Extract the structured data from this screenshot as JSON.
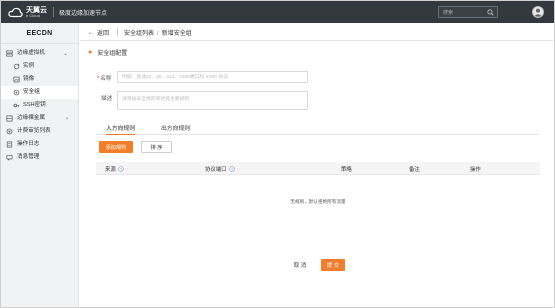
{
  "topbar": {
    "logo_main": "天翼云",
    "logo_sub": "e Cloud",
    "title": "极度边缘加速节点",
    "search_placeholder": "搜索"
  },
  "sidebar": {
    "brand": "EECDN",
    "items": [
      {
        "label": "边缘虚拟机",
        "icon": "server-icon",
        "expandable": true
      },
      {
        "label": "实例",
        "icon": "refresh-icon"
      },
      {
        "label": "镜像",
        "icon": "image-icon"
      },
      {
        "label": "安全组",
        "icon": "shield-icon",
        "active": true
      },
      {
        "label": "SSH密钥",
        "icon": "key-icon"
      },
      {
        "label": "边缘裸金属",
        "icon": "metal-server-icon",
        "expandable": true
      },
      {
        "label": "计费审览列表",
        "icon": "billing-icon"
      },
      {
        "label": "操作日志",
        "icon": "log-icon"
      },
      {
        "label": "消息管理",
        "icon": "message-icon"
      }
    ]
  },
  "breadcrumb": {
    "back": "返回",
    "parent": "安全组列表",
    "separator": "/",
    "current": "新增安全组"
  },
  "form": {
    "section_title": "安全组配置",
    "name_label": "名称",
    "name_required_mark": "*",
    "name_placeholder": "例如：放通22、80、443、3389端口和 ICMP 协议",
    "desc_label": "描述",
    "desc_placeholder": "请添加安全组的简述或主要规则"
  },
  "tabs": {
    "inbound": "入方向规则",
    "outbound": "出方向规则"
  },
  "buttons": {
    "add_rule": "添加规则",
    "sort": "排 序",
    "cancel": "取 消",
    "submit": "提 交"
  },
  "table": {
    "columns": [
      "来源",
      "协议端口",
      "策略",
      "备注",
      "操作"
    ],
    "empty_text": "无规则，默认拒绝所有流量"
  },
  "colors": {
    "accent": "#f27d2b",
    "topbar": "#34393f",
    "sidebar": "#f1f2f4"
  }
}
